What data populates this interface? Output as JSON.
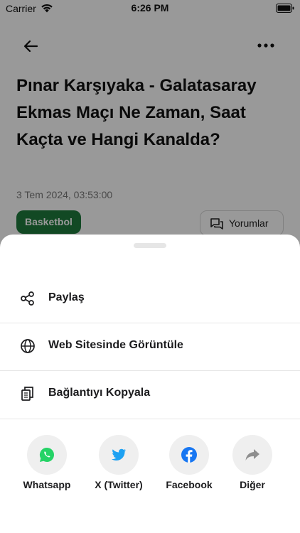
{
  "status_bar": {
    "carrier": "Carrier",
    "time": "6:26 PM"
  },
  "article": {
    "title": "Pınar Karşıyaka - Galatasaray Ekmas Maçı Ne Zaman, Saat Kaçta ve Hangi Kanalda?",
    "date": "3 Tem 2024, 03:53:00",
    "category": "Basketbol",
    "comments_label": "Yorumlar"
  },
  "sheet": {
    "menu": [
      {
        "label": "Paylaş",
        "icon": "share-icon"
      },
      {
        "label": "Web Sitesinde Görüntüle",
        "icon": "globe-icon"
      },
      {
        "label": "Bağlantıyı Kopyala",
        "icon": "copy-icon"
      }
    ],
    "share_targets": [
      {
        "label": "Whatsapp",
        "icon": "whatsapp-icon",
        "color": "#25D366"
      },
      {
        "label": "X (Twitter)",
        "icon": "twitter-icon",
        "color": "#1DA1F2"
      },
      {
        "label": "Facebook",
        "icon": "facebook-icon",
        "color": "#1877F2"
      },
      {
        "label": "Diğer",
        "icon": "forward-icon",
        "color": "#8e8e8e"
      }
    ]
  },
  "colors": {
    "badge": "#1f7a3d",
    "overlay": "rgba(0,0,0,0.40)"
  }
}
